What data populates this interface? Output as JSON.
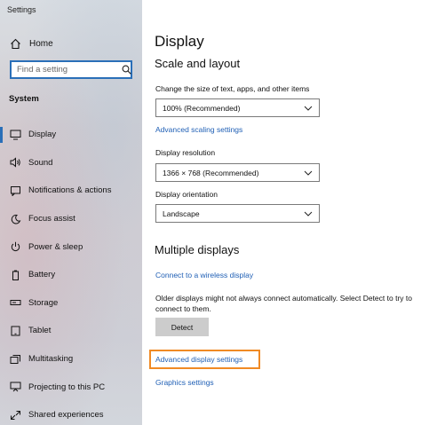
{
  "window": {
    "title": "Settings"
  },
  "sidebar": {
    "home_label": "Home",
    "search_placeholder": "Find a setting",
    "section_label": "System",
    "items": [
      {
        "label": "Display",
        "icon": "monitor-icon",
        "active": true
      },
      {
        "label": "Sound",
        "icon": "speaker-icon"
      },
      {
        "label": "Notifications & actions",
        "icon": "notification-icon"
      },
      {
        "label": "Focus assist",
        "icon": "moon-icon"
      },
      {
        "label": "Power & sleep",
        "icon": "power-icon"
      },
      {
        "label": "Battery",
        "icon": "battery-icon"
      },
      {
        "label": "Storage",
        "icon": "storage-icon"
      },
      {
        "label": "Tablet",
        "icon": "tablet-icon"
      },
      {
        "label": "Multitasking",
        "icon": "multitasking-icon"
      },
      {
        "label": "Projecting to this PC",
        "icon": "projecting-icon"
      },
      {
        "label": "Shared experiences",
        "icon": "shared-icon"
      }
    ]
  },
  "main": {
    "title": "Display",
    "scale_heading": "Scale and layout",
    "scale_label": "Change the size of text, apps, and other items",
    "scale_value": "100% (Recommended)",
    "advanced_scaling_link": "Advanced scaling settings",
    "resolution_label": "Display resolution",
    "resolution_value": "1366 × 768 (Recommended)",
    "orientation_label": "Display orientation",
    "orientation_value": "Landscape",
    "multiple_heading": "Multiple displays",
    "wireless_link": "Connect to a wireless display",
    "detect_text": "Older displays might not always connect automatically. Select Detect to try to connect to them.",
    "detect_button": "Detect",
    "advanced_display_link": "Advanced display settings",
    "graphics_link": "Graphics settings"
  },
  "colors": {
    "accent": "#2a6fb8",
    "link": "#1f5fb5",
    "highlight": "#f08a24"
  }
}
